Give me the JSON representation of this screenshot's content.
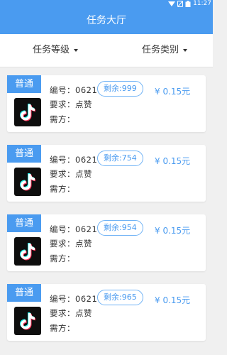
{
  "status": {
    "time": "11:27"
  },
  "header": {
    "title": "任务大厅"
  },
  "filters": [
    {
      "label": "任务等级"
    },
    {
      "label": "任务类别"
    }
  ],
  "labels": {
    "number_prefix": "编号：",
    "requirement_prefix": "要求：",
    "demander": "需方："
  },
  "tasks": [
    {
      "level": "普通",
      "number": "0621",
      "requirement": "点赞",
      "remaining": "剩余:999",
      "price": "¥ 0.15元",
      "app_icon": "tiktok-icon"
    },
    {
      "level": "普通",
      "number": "0621",
      "requirement": "点赞",
      "remaining": "剩余:754",
      "price": "¥ 0.15元",
      "app_icon": "tiktok-icon"
    },
    {
      "level": "普通",
      "number": "0621",
      "requirement": "点赞",
      "remaining": "剩余:954",
      "price": "¥ 0.15元",
      "app_icon": "tiktok-icon"
    },
    {
      "level": "普通",
      "number": "0621",
      "requirement": "点赞",
      "remaining": "剩余:965",
      "price": "¥ 0.15元",
      "app_icon": "tiktok-icon"
    }
  ],
  "colors": {
    "primary": "#4a9bf0",
    "background": "#f0f0f0",
    "card": "#ffffff"
  }
}
